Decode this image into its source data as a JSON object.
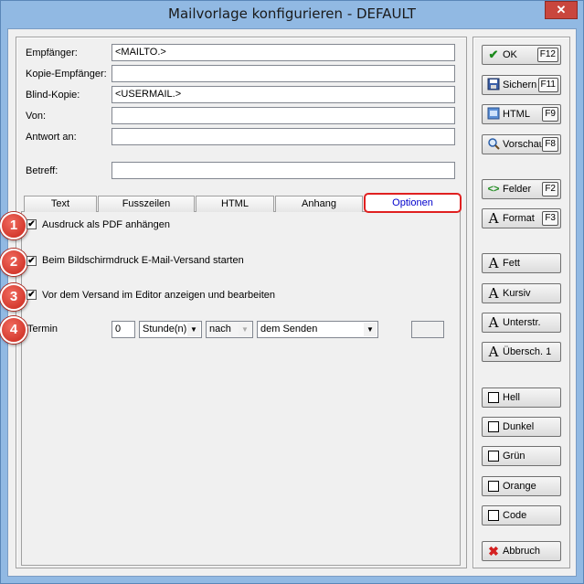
{
  "window": {
    "title": "Mailvorlage konfigurieren - DEFAULT",
    "close_glyph": "✕"
  },
  "fields": [
    {
      "label": "Empfänger:",
      "value": "<MAILTO.>"
    },
    {
      "label": "Kopie-Empfänger:",
      "value": ""
    },
    {
      "label": "Blind-Kopie:",
      "value": "<USERMAIL.>"
    },
    {
      "label": "Von:",
      "value": ""
    },
    {
      "label": "Antwort an:",
      "value": ""
    },
    {
      "label": "Betreff:",
      "value": ""
    }
  ],
  "tabs": [
    "Text",
    "Fusszeilen",
    "HTML",
    "Anhang",
    "Optionen"
  ],
  "active_tab": "Optionen",
  "options": [
    {
      "badge": "1",
      "label": "Ausdruck als PDF anhängen",
      "checked": true
    },
    {
      "badge": "2",
      "label": "Beim Bildschirmdruck E-Mail-Versand starten",
      "checked": true
    },
    {
      "badge": "3",
      "label": "Vor dem Versand im Editor anzeigen und bearbeiten",
      "checked": true
    }
  ],
  "termin": {
    "badge": "4",
    "label": "Termin",
    "amount": "0",
    "unit": "Stunde(n)",
    "relation": "nach",
    "event": "dem Senden"
  },
  "buttons": [
    {
      "label": "OK",
      "key": "F12",
      "icon": "check-icon"
    },
    {
      "label": "Sichern",
      "key": "F11",
      "icon": "save-icon"
    },
    {
      "label": "HTML",
      "key": "F9",
      "icon": "html-icon"
    },
    {
      "label": "Vorschau",
      "key": "F8",
      "icon": "preview-icon"
    },
    {
      "label": "Felder",
      "key": "F2",
      "icon": "fields-icon"
    },
    {
      "label": "Format",
      "key": "F3",
      "icon": "format-icon"
    },
    {
      "label": "Fett",
      "key": "",
      "icon": "bold-icon"
    },
    {
      "label": "Kursiv",
      "key": "",
      "icon": "italic-icon"
    },
    {
      "label": "Unterstr.",
      "key": "",
      "icon": "underline-icon"
    },
    {
      "label": "Übersch. 1",
      "key": "",
      "icon": "heading-icon"
    },
    {
      "label": "Hell",
      "key": "",
      "icon": "box-icon"
    },
    {
      "label": "Dunkel",
      "key": "",
      "icon": "box-icon"
    },
    {
      "label": "Grün",
      "key": "",
      "icon": "box-icon"
    },
    {
      "label": "Orange",
      "key": "",
      "icon": "box-icon"
    },
    {
      "label": "Code",
      "key": "",
      "icon": "box-icon"
    },
    {
      "label": "Abbruch",
      "key": "",
      "icon": "cancel-icon"
    }
  ],
  "glyphs": {
    "check": "✔",
    "dropdown": "▼"
  },
  "colors": {
    "accent_red": "#e02020",
    "active_tab_text": "#0000cc",
    "ok_check": "#1c8a1c",
    "cancel_x": "#d42020"
  }
}
